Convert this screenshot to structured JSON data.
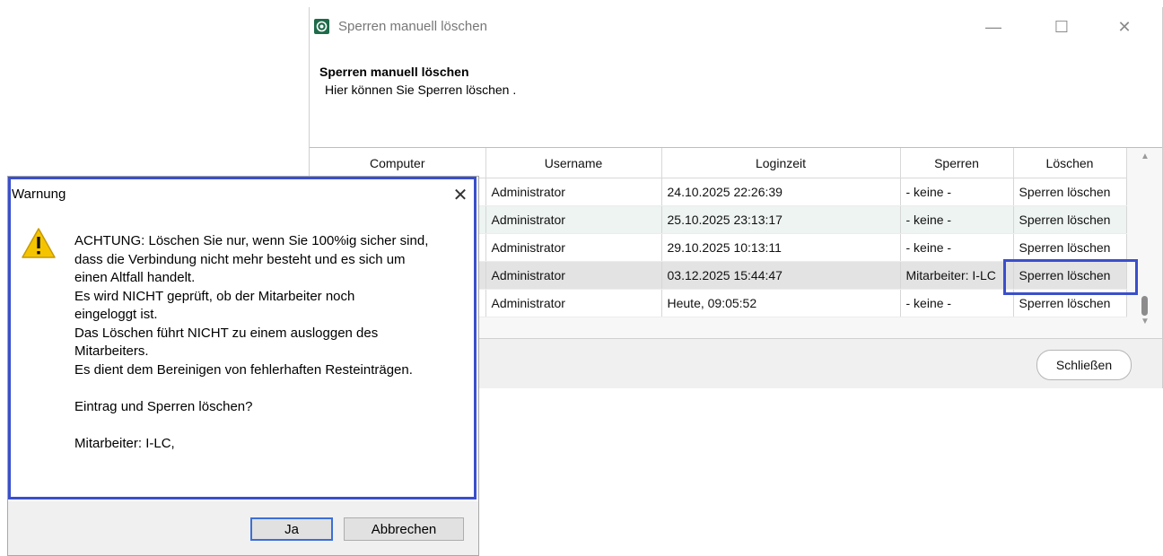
{
  "main_window": {
    "title": "Sperren manuell löschen",
    "header_title": "Sperren manuell löschen",
    "header_subtitle": "Hier können Sie Sperren löschen .",
    "controls": {
      "minimize": "—",
      "maximize": "☐",
      "close": "✕"
    },
    "table": {
      "columns": [
        "Computer",
        "Username",
        "Loginzeit",
        "Sperren",
        "Löschen"
      ],
      "rows": [
        {
          "computer": "",
          "username": "Administrator",
          "loginzeit": "24.10.2025 22:26:39",
          "sperren": "- keine -",
          "loeschen": "Sperren löschen"
        },
        {
          "computer": "",
          "username": "Administrator",
          "loginzeit": "25.10.2025 23:13:17",
          "sperren": "- keine -",
          "loeschen": "Sperren löschen"
        },
        {
          "computer": "",
          "username": "Administrator",
          "loginzeit": "29.10.2025 10:13:11",
          "sperren": "- keine -",
          "loeschen": "Sperren löschen"
        },
        {
          "computer": "",
          "username": "Administrator",
          "loginzeit": "03.12.2025 15:44:47",
          "sperren": "Mitarbeiter: I-LC",
          "loeschen": "Sperren löschen"
        },
        {
          "computer": "",
          "username": "Administrator",
          "loginzeit": "Heute, 09:05:52",
          "sperren": "- keine -",
          "loeschen": "Sperren löschen"
        }
      ]
    },
    "close_button": "Schließen"
  },
  "warning_dialog": {
    "title": "Warnung",
    "close": "✕",
    "message_lines": [
      "ACHTUNG: Löschen Sie nur, wenn Sie 100%ig sicher sind,",
      "dass die Verbindung nicht mehr besteht und es sich um",
      "einen Altfall handelt.",
      "Es wird NICHT geprüft, ob der Mitarbeiter noch",
      "eingeloggt ist.",
      "Das Löschen führt NICHT zu einem ausloggen des",
      "Mitarbeiters.",
      "Es dient dem Bereinigen von fehlerhaften Resteinträgen."
    ],
    "question": "Eintrag und Sperren löschen?",
    "employee": "Mitarbeiter: I-LC,",
    "yes_button": "Ja",
    "cancel_button": "Abbrechen"
  },
  "colors": {
    "highlight": "#3a4fcc",
    "row_alt": "#edf4f1",
    "row_selected": "#e3e3e3",
    "warning_yellow": "#f5c400"
  },
  "icons": {
    "app": "app-icon",
    "warning": "warning-icon"
  }
}
